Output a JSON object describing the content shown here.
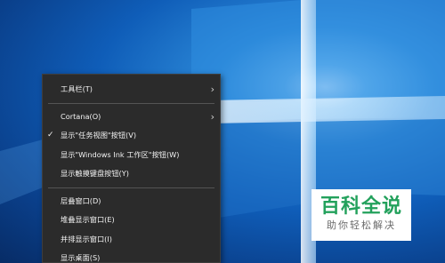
{
  "context_menu": {
    "items": [
      {
        "label": "工具栏(T)",
        "checked": false,
        "submenu": true
      },
      {
        "label": "Cortana(O)",
        "checked": false,
        "submenu": true
      },
      {
        "label": "显示\"任务视图\"按钮(V)",
        "checked": true,
        "submenu": false
      },
      {
        "label": "显示\"Windows Ink 工作区\"按钮(W)",
        "checked": false,
        "submenu": false
      },
      {
        "label": "显示触摸键盘按钮(Y)",
        "checked": false,
        "submenu": false
      },
      {
        "label": "层叠窗口(D)",
        "checked": false,
        "submenu": false
      },
      {
        "label": "堆叠显示窗口(E)",
        "checked": false,
        "submenu": false
      },
      {
        "label": "并排显示窗口(I)",
        "checked": false,
        "submenu": false
      },
      {
        "label": "显示桌面(S)",
        "checked": false,
        "submenu": false
      }
    ]
  },
  "watermark": {
    "title": "百科全说",
    "subtitle": "助你轻松解决"
  },
  "icons": {
    "check": "checkmark-icon",
    "submenu": "chevron-right-icon"
  },
  "colors": {
    "menu_bg": "#2b2b2b",
    "menu_text": "#f2f2f2",
    "watermark_green": "#23a15c",
    "desktop_blue": "#0f5db8"
  }
}
